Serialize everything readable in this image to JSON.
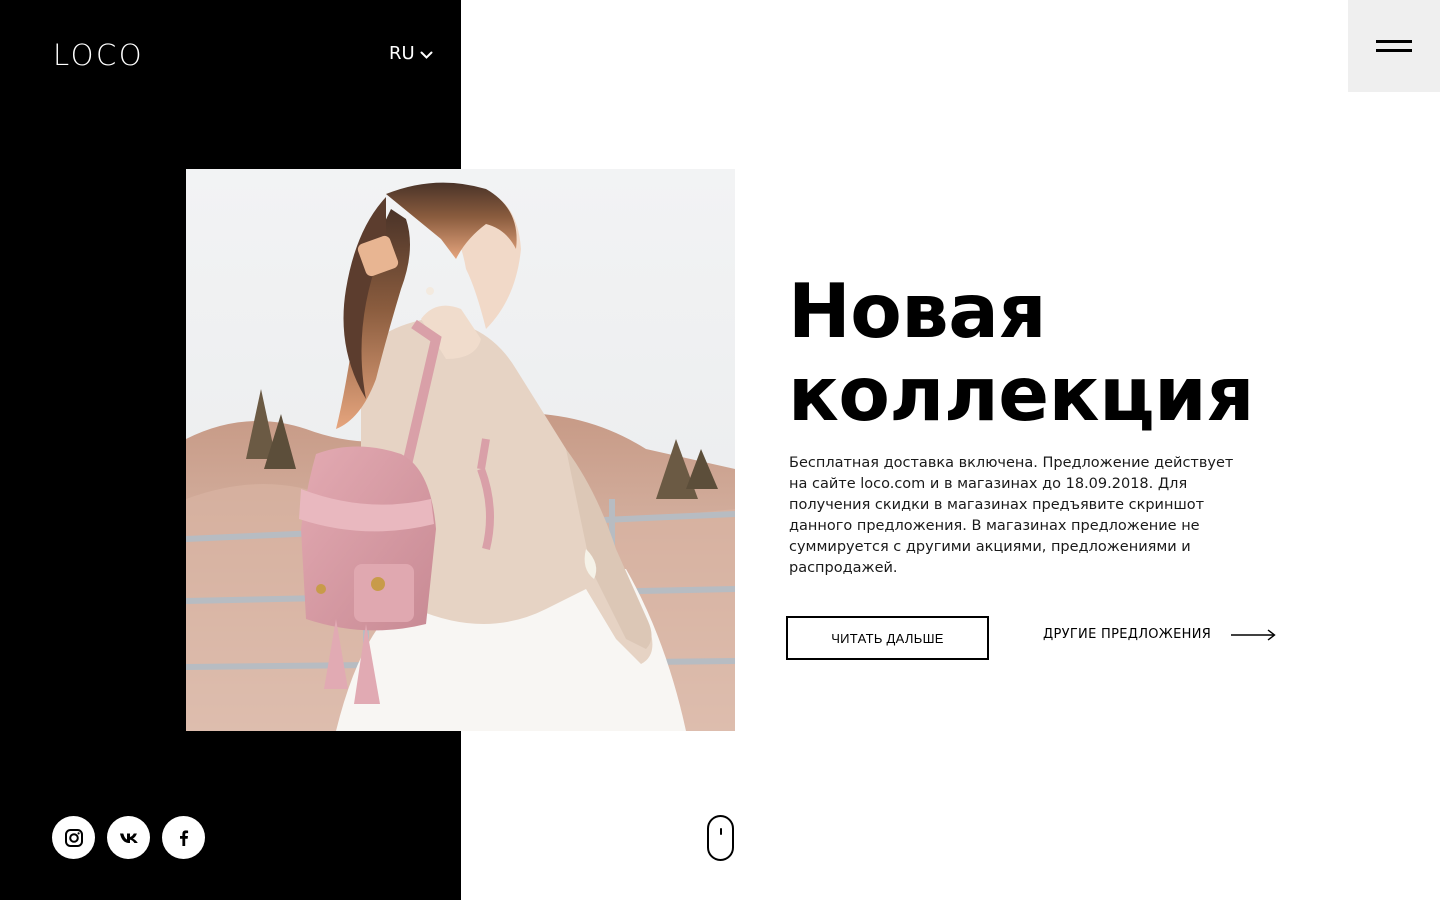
{
  "brand": {
    "logo": "LOCO"
  },
  "header": {
    "language": "RU",
    "icons": {
      "language_toggle": "chevron-down-icon",
      "menu": "hamburger-menu-icon"
    }
  },
  "hero": {
    "image_description": "",
    "title_line1": "Новая",
    "title_line2": "коллекция",
    "description": "Бесплатная доставка включена. Предложение действует на сайте loco.com и в магазинах до 18.09.2018. Для получения скидки в магазинах предъявите скриншот данного предложения. В магазинах предложение не суммируется с другими акциями, предложениями и распродажей.",
    "primary_button": "ЧИТАТЬ ДАЛЬШЕ",
    "secondary_link": "ДРУГИЕ ПРЕДЛОЖЕНИЯ",
    "secondary_link_icon": "arrow-right-icon"
  },
  "socials": [
    {
      "icon": "instagram-icon"
    },
    {
      "icon": "vk-icon"
    },
    {
      "icon": "facebook-icon"
    }
  ],
  "scroll_indicator": {
    "icon": "mouse-scroll-icon"
  },
  "colors": {
    "panel": "#000000",
    "background": "#ffffff",
    "menu_bg": "#efefef",
    "text": "#000000",
    "backpack": "#d9a0a8"
  }
}
